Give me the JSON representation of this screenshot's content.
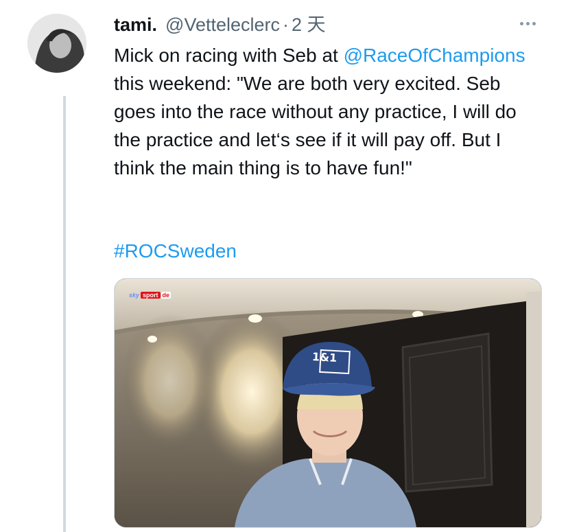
{
  "tweet": {
    "author_name": "tami.",
    "author_handle": "@Vetteleclerc",
    "separator": "·",
    "timestamp": "2 天",
    "text_before_mention": "Mick on racing with Seb at ",
    "mention": "@RaceOfChampions",
    "text_after_mention": " this weekend: \"We are both very excited. Seb goes into the race without any practice, I will do the practice and let‘s see if it will pay off. But I think the main thing is to have fun!\"",
    "hashtag": "#ROCSweden",
    "more_icon": "more-horizontal-icon"
  },
  "media": {
    "broadcaster_sky": "sky",
    "broadcaster_sport": "sport",
    "broadcaster_de": "de",
    "cap_logo": "1&1"
  },
  "colors": {
    "link": "#1d9bf0",
    "secondary_text": "#536471",
    "primary_text": "#0f1419",
    "thread_line": "#cfd9de"
  }
}
